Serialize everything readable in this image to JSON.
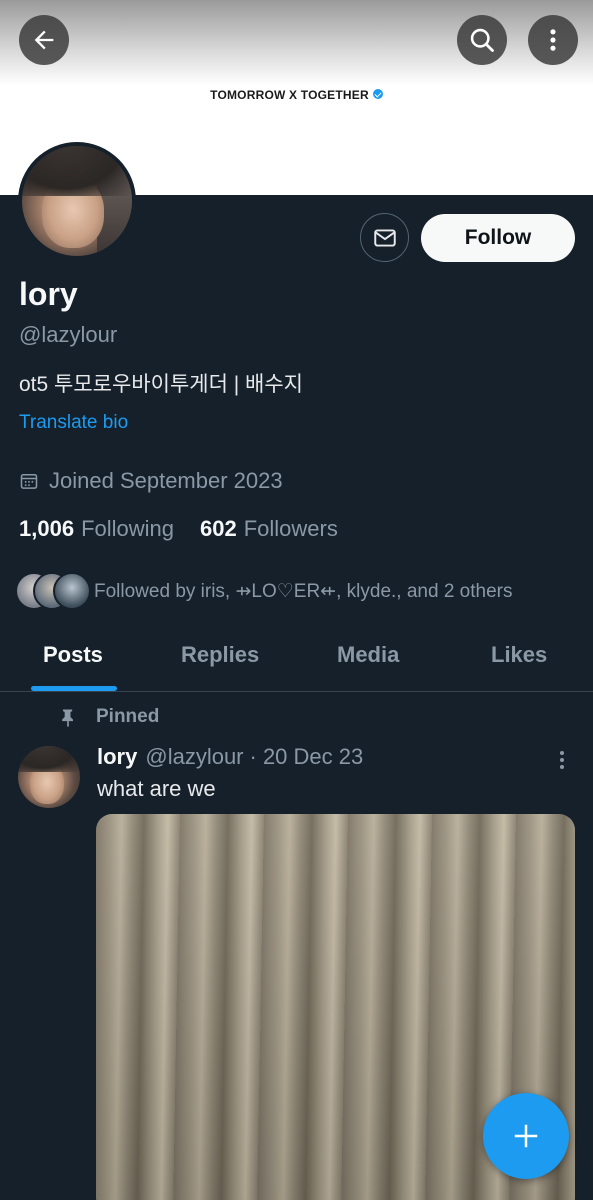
{
  "banner": {
    "text": "TOMORROW X TOGETHER"
  },
  "header_icons": {
    "back": "arrow-left-icon",
    "search": "search-icon",
    "more": "more-vertical-icon"
  },
  "profile": {
    "display_name": "lory",
    "handle": "@lazylour",
    "bio": "ot5 투모로우바이투게더 | 배수지",
    "translate_bio": "Translate bio",
    "joined": "Joined September 2023",
    "following_count": "1,006",
    "following_label": "Following",
    "followers_count": "602",
    "followers_label": "Followers",
    "followed_by": "Followed by iris, ⇸LO♡ER⇷, klyde., and 2 others"
  },
  "actions": {
    "follow_label": "Follow",
    "message_icon": "mail-icon"
  },
  "tabs": [
    {
      "label": "Posts",
      "active": true
    },
    {
      "label": "Replies",
      "active": false
    },
    {
      "label": "Media",
      "active": false
    },
    {
      "label": "Likes",
      "active": false
    }
  ],
  "pinned_post": {
    "pinned_label": "Pinned",
    "author_name": "lory",
    "author_handle": "@lazylour",
    "date": "· 20 Dec 23",
    "text": "what are we"
  },
  "fab": {
    "icon": "plus-icon"
  },
  "colors": {
    "accent": "#1d9bf0",
    "background": "#15202b",
    "secondary_text": "#8b98a5",
    "follow_button": "#f7f9f9"
  }
}
